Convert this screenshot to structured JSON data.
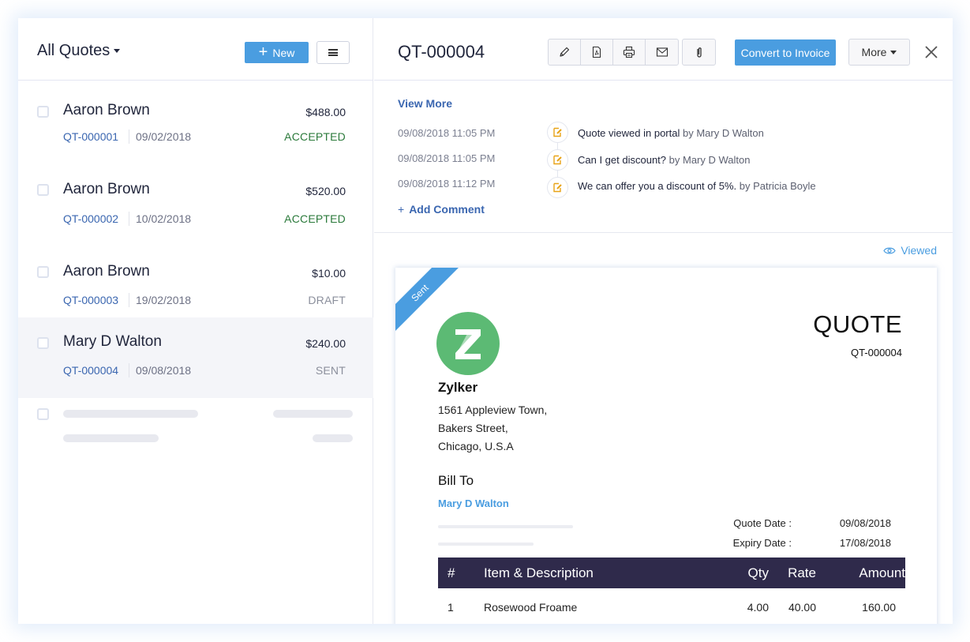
{
  "list_panel": {
    "view_title": "All Quotes",
    "new_button": "New",
    "menu_icon": "hamburger-menu-icon",
    "quotes": [
      {
        "customer": "Aaron Brown",
        "amount": "$488.00",
        "quote_number": "QT-000001",
        "date": "09/02/2018",
        "status": "ACCEPTED"
      },
      {
        "customer": "Aaron Brown",
        "amount": "$520.00",
        "quote_number": "QT-000002",
        "date": "10/02/2018",
        "status": "ACCEPTED"
      },
      {
        "customer": "Aaron Brown",
        "amount": "$10.00",
        "quote_number": "QT-000003",
        "date": "19/02/2018",
        "status": "DRAFT"
      },
      {
        "customer": "Mary D Walton",
        "amount": "$240.00",
        "quote_number": "QT-000004",
        "date": "09/08/2018",
        "status": "SENT",
        "selected": true
      }
    ]
  },
  "detail": {
    "title": "QT-000004",
    "toolbar": {
      "icons": [
        "edit-pencil-icon",
        "pdf-icon",
        "print-icon",
        "email-icon",
        "attachment-icon"
      ],
      "convert_button": "Convert to Invoice",
      "more_button": "More",
      "close_icon": "close-icon"
    },
    "history": {
      "view_more": "View More",
      "entries": [
        {
          "time": "09/08/2018  11:05 PM",
          "text": "Quote viewed in portal",
          "by": "by Mary D Walton"
        },
        {
          "time": "09/08/2018  11:05 PM",
          "text": "Can I get discount?",
          "by": "by Mary D Walton"
        },
        {
          "time": "09/08/2018  11:12 PM",
          "text": "We can offer you a discount of 5%.",
          "by": "by Patricia Boyle"
        }
      ],
      "add_comment": "Add Comment"
    },
    "viewed_label": "Viewed",
    "document": {
      "ribbon": "Sent",
      "logo_letter": "Z",
      "company": "Zylker",
      "address": [
        "1561 Appleview Town,",
        "Bakers Street,",
        "Chicago, U.S.A"
      ],
      "doc_type": "QUOTE",
      "doc_number": "QT-000004",
      "bill_to_label": "Bill To",
      "bill_to_name": "Mary D Walton",
      "quote_date_label": "Quote Date :",
      "quote_date": "09/08/2018",
      "expiry_date_label": "Expiry Date :",
      "expiry_date": "17/08/2018",
      "table": {
        "headers": [
          "#",
          "Item & Description",
          "Qty",
          "Rate",
          "Amount"
        ],
        "rows": [
          {
            "num": "1",
            "item": "Rosewood Froame",
            "qty": "4.00",
            "rate": "40.00",
            "amount": "160.00"
          }
        ]
      }
    }
  },
  "colors": {
    "accent": "#4a9de0",
    "link": "#3a66b0",
    "accepted": "#2b7a3b",
    "table_header": "#2f2a4b",
    "logo_green": "#5cba74",
    "history_icon": "#e8a317"
  }
}
